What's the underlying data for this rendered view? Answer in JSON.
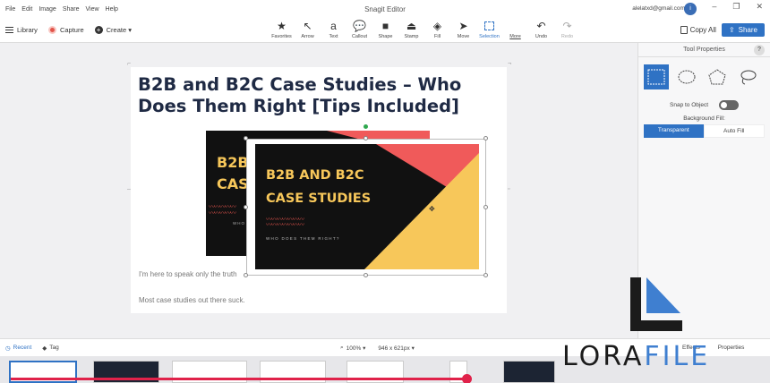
{
  "titlebar": {
    "menu": [
      "File",
      "Edit",
      "Image",
      "Share",
      "View",
      "Help"
    ],
    "title": "Snagit Editor",
    "account": "alelatxd@gmail.com ▾"
  },
  "toolbar": {
    "library": "Library",
    "capture": "Capture",
    "create": "Create ▾",
    "tools": [
      {
        "label": "Favorites",
        "icon": "star-icon"
      },
      {
        "label": "Arrow",
        "icon": "arrow-icon"
      },
      {
        "label": "Text",
        "icon": "text-icon"
      },
      {
        "label": "Callout",
        "icon": "callout-icon"
      },
      {
        "label": "Shape",
        "icon": "shape-icon"
      },
      {
        "label": "Stamp",
        "icon": "stamp-icon"
      },
      {
        "label": "Fill",
        "icon": "fill-icon"
      },
      {
        "label": "Move",
        "icon": "move-icon"
      },
      {
        "label": "Selection",
        "icon": "selection-icon"
      },
      {
        "label": "More",
        "icon": "more-icon"
      },
      {
        "label": "Undo",
        "icon": "undo-icon"
      },
      {
        "label": "Redo",
        "icon": "redo-icon"
      }
    ],
    "copy_all": "Copy All",
    "share": "Share"
  },
  "document": {
    "title": "B2B and B2C Case Studies – Who Does Them Right [Tips Included]",
    "paragraph_1": "I'm here to speak only the truth",
    "paragraph_2": "Most case studies out there suck."
  },
  "image_back": {
    "title_lines": [
      "B2B",
      "CAS"
    ],
    "subtitle": "WHO DOES"
  },
  "image_front": {
    "title_lines": [
      "B2B AND B2C",
      "CASE STUDIES"
    ],
    "subtitle": "WHO DOES THEM RIGHT?"
  },
  "tool_properties": {
    "title": "Tool Properties",
    "help": "?",
    "snap_to_object": "Snap to Object",
    "background_fill": "Background Fill:",
    "fill_options": [
      "Transparent",
      "Auto Fill"
    ]
  },
  "bottombar": {
    "recent": "Recent",
    "tag": "Tag",
    "zoom": "100% ▾",
    "dimensions": "946 x 621px ▾",
    "effects": "Effects",
    "properties": "Properties"
  },
  "watermark": {
    "part1": "LORA",
    "part2": "FILE"
  },
  "colors": {
    "accent": "#2f72c4",
    "title_text": "#1f2a44",
    "image_yellow": "#f7c75a",
    "image_red": "#f05a5a",
    "progress_red": "#e0224a"
  }
}
